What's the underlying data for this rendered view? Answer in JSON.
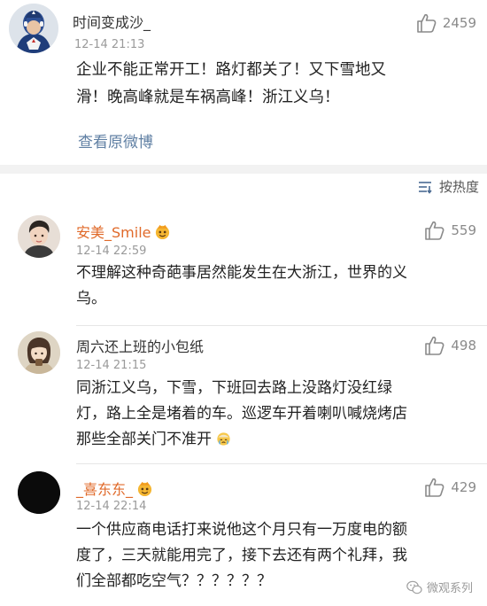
{
  "post": {
    "user": "时间变成沙_",
    "time": "12-14 21:13",
    "likes": "2459",
    "text_line1": "企业不能正常开工！路灯都关了！又下雪地又",
    "text_line2": "滑！晚高峰就是车祸高峰！浙江义乌！",
    "view_original": "查看原微博"
  },
  "sort": {
    "label": "按热度"
  },
  "comments": [
    {
      "user": "安美_Smile",
      "time": "12-14 22:59",
      "likes": "559",
      "line1": "不理解这种奇葩事居然能发生在大浙江，世界的义",
      "line2": "乌。"
    },
    {
      "user": "周六还上班的小包纸",
      "time": "12-14 21:15",
      "likes": "498",
      "line1": "同浙江义乌，下雪，下班回去路上没路灯没红绿",
      "line2": "灯，路上全是堵着的车。巡逻车开着喇叭喊烧烤店",
      "line3": "那些全部关门不准开"
    },
    {
      "user": "_喜东东_",
      "time": "12-14 22:14",
      "likes": "429",
      "line1": "一个供应商电话打来说他这个月只有一万度电的额",
      "line2": "度了，三天就能用完了，接下去还有两个礼拜，我",
      "line3": "们全部都吃空气？？？？？？"
    }
  ],
  "watermark": {
    "text": "微观系列"
  },
  "colors": {
    "link": "#5f7fa3",
    "username_highlight": "#e06a2a",
    "meta_gray": "#9a9a9a",
    "separator": "#f2f2f2"
  }
}
